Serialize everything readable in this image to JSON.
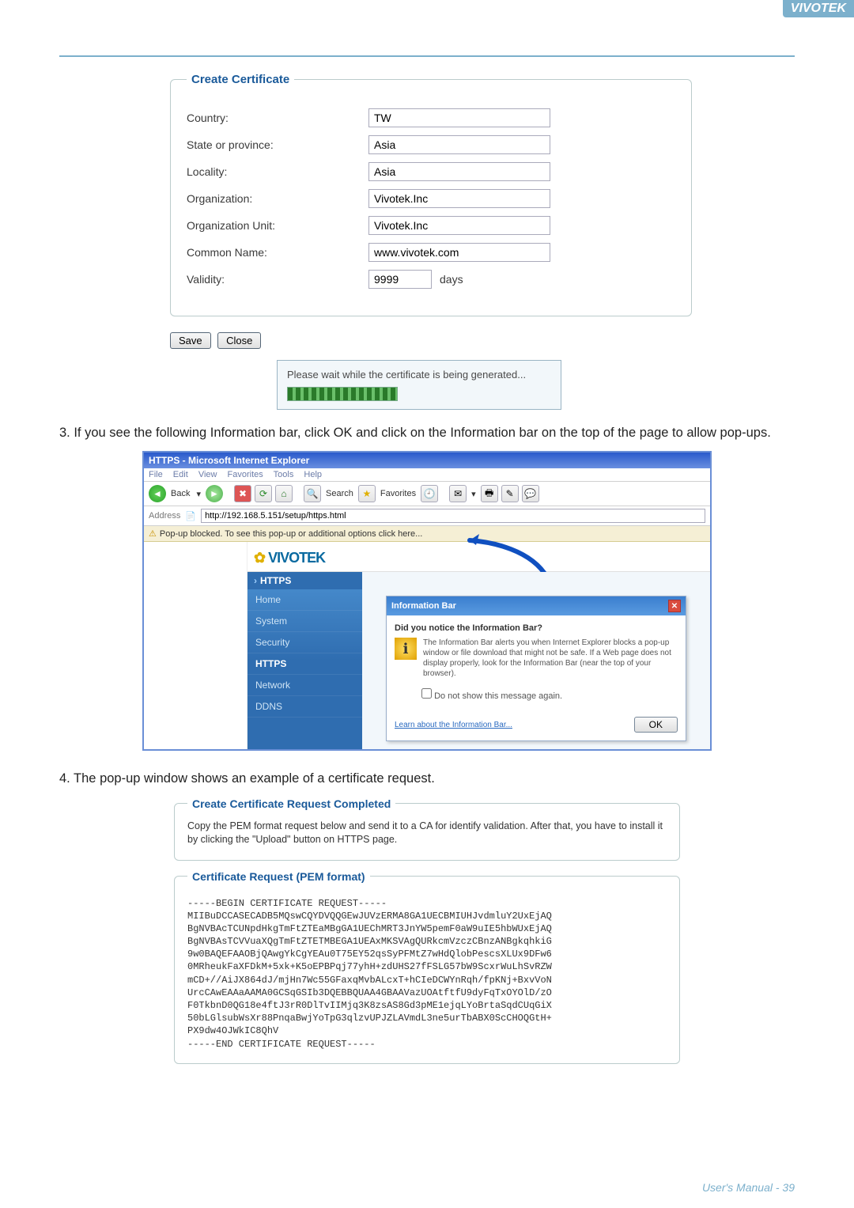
{
  "brand": "VIVOTEK",
  "create_cert": {
    "legend": "Create Certificate",
    "rows": {
      "country": {
        "label": "Country:",
        "value": "TW"
      },
      "state": {
        "label": "State or province:",
        "value": "Asia"
      },
      "locality": {
        "label": "Locality:",
        "value": "Asia"
      },
      "org": {
        "label": "Organization:",
        "value": "Vivotek.Inc"
      },
      "orgunit": {
        "label": "Organization Unit:",
        "value": "Vivotek.Inc"
      },
      "cn": {
        "label": "Common Name:",
        "value": "www.vivotek.com"
      },
      "validity": {
        "label": "Validity:",
        "value": "9999",
        "unit": "days"
      }
    },
    "buttons": {
      "save": "Save",
      "close": "Close"
    },
    "gen_msg": "Please wait while the certificate is being generated..."
  },
  "step3": "3. If you see the following Information bar, click OK and click on the Information bar on the top of the page to allow pop-ups.",
  "ie": {
    "title": "HTTPS - Microsoft Internet Explorer",
    "menu": [
      "File",
      "Edit",
      "View",
      "Favorites",
      "Tools",
      "Help"
    ],
    "back": "Back",
    "search": "Search",
    "favorites": "Favorites",
    "addr_label": "Address",
    "addr": "http://192.168.5.151/setup/https.html",
    "popup_bar": "Pop-up blocked. To see this pop-up or additional options click here...",
    "logo": "VIVOTEK",
    "crumb": "HTTPS",
    "nav": [
      "Home",
      "System",
      "Security",
      "HTTPS",
      "Network",
      "DDNS"
    ],
    "dialog": {
      "title": "Information Bar",
      "question": "Did you notice the Information Bar?",
      "body": "The Information Bar alerts you when Internet Explorer blocks a pop-up window or file download that might not be safe. If a Web page does not display properly, look for the Information Bar (near the top of your browser).",
      "checkbox": "Do not show this message again.",
      "link": "Learn about the Information Bar...",
      "ok": "OK"
    }
  },
  "step4": "4. The pop-up window shows an example of a certificate request.",
  "cert_req": {
    "legend1": "Create Certificate Request Completed",
    "desc": "Copy the PEM format request below and send it to a CA for identify validation. After that, you have to install it by clicking the \"Upload\" button on HTTPS page.",
    "legend2": "Certificate Request (PEM format)",
    "pem": "-----BEGIN CERTIFICATE REQUEST-----\nMIIBuDCCASECADB5MQswCQYDVQQGEwJUVzERMA8GA1UECBMIUHJvdmluY2UxEjAQ\nBgNVBAcTCUNpdHkgTmFtZTEaMBgGA1UEChMRT3JnYW5pemF0aW9uIE5hbWUxEjAQ\nBgNVBAsTCVVuaXQgTmFtZTETMBEGA1UEAxMKSVAgQURkcmVzczCBnzANBgkqhkiG\n9w0BAQEFAAOBjQAwgYkCgYEAu0T75EY52qsSyPFMtZ7wHdQlobPescsXLUx9DFw6\n0MRheukFaXFDkM+5xk+K5oEPBPqj77yhH+zdUHS27fFSLG57bW9ScxrWuLhSvRZW\nmCD+//AiJX864dJ/mjHn7Wc55GFaxqMvbALcxT+hCIeDCWYnRqh/fpKNj+BxvVoN\nUrcCAwEAAaAAMA0GCSqGSIb3DQEBBQUAA4GBAAVazUOAtftfU9dyFqTxOYOlD/zO\nF0TkbnD0QG18e4ftJ3rR0DlTvIIMjq3K8zsAS8Gd3pME1ejqLYoBrtaSqdCUqGiX\n50bLGlsubWsXr88PnqaBwjYoTpG3qlzvUPJZLAVmdL3ne5urTbABX0ScCHOQGtH+\nPX9dw4OJWkIC8QhV\n-----END CERTIFICATE REQUEST-----"
  },
  "footer": {
    "label": "User's Manual - ",
    "page": "39"
  }
}
